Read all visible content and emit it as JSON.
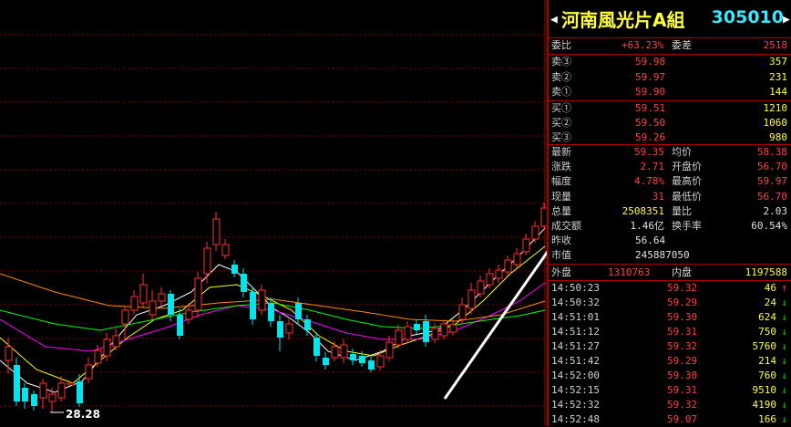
{
  "header": {
    "name": "河南風光片A組",
    "code": "305010"
  },
  "committee": {
    "ratio_label": "委比",
    "ratio_value": "+63.23%",
    "diff_label": "委差",
    "diff_value": "2518"
  },
  "sell": [
    {
      "label": "卖③",
      "price": "59.98",
      "vol": "357"
    },
    {
      "label": "卖②",
      "price": "59.97",
      "vol": "231"
    },
    {
      "label": "卖①",
      "price": "59.90",
      "vol": "144"
    }
  ],
  "buy": [
    {
      "label": "买①",
      "price": "59.51",
      "vol": "1210"
    },
    {
      "label": "买②",
      "price": "59.50",
      "vol": "1060"
    },
    {
      "label": "买③",
      "price": "59.26",
      "vol": "980"
    }
  ],
  "stats": [
    {
      "l1": "最新",
      "v1": "59.35",
      "l2": "均价",
      "v2": "58.38"
    },
    {
      "l1": "涨跌",
      "v1": "2.71",
      "l2": "开盘价",
      "v2": "56.70"
    },
    {
      "l1": "幅度",
      "v1": "4.78%",
      "l2": "最高价",
      "v2": "59.97"
    },
    {
      "l1": "现量",
      "v1": "31",
      "l2": "最低价",
      "v2": "56.70"
    },
    {
      "l1": "总量",
      "v1": "2508351",
      "l2": "量比",
      "v2": "2.03"
    },
    {
      "l1": "成交额",
      "v1": "1.46亿",
      "l2": "换手率",
      "v2": "60.54%"
    },
    {
      "l1": "昨收",
      "v1": "56.64",
      "l2": "",
      "v2": ""
    },
    {
      "l1": "市值",
      "v1": "245887050",
      "l2": "",
      "v2": ""
    }
  ],
  "outer": {
    "out_label": "外盘",
    "out_value": "1310763",
    "in_label": "内盘",
    "in_value": "1197588"
  },
  "ticks": [
    {
      "time": "14:50:23",
      "price": "59.32",
      "vol": "46",
      "dir": "up"
    },
    {
      "time": "14:50:32",
      "price": "59.29",
      "vol": "24",
      "dir": "down"
    },
    {
      "time": "14:51:01",
      "price": "59.30",
      "vol": "624",
      "dir": "down"
    },
    {
      "time": "14:51:12",
      "price": "59.31",
      "vol": "750",
      "dir": "down"
    },
    {
      "time": "14:51:27",
      "price": "59.32",
      "vol": "5760",
      "dir": "down"
    },
    {
      "time": "14:51:42",
      "price": "59.29",
      "vol": "214",
      "dir": "down"
    },
    {
      "time": "14:52:00",
      "price": "59.30",
      "vol": "760",
      "dir": "down"
    },
    {
      "time": "14:52:15",
      "price": "59.31",
      "vol": "9510",
      "dir": "down"
    },
    {
      "time": "14:52:32",
      "price": "59.32",
      "vol": "4190",
      "dir": "down"
    },
    {
      "time": "14:52:48",
      "price": "59.07",
      "vol": "166",
      "dir": "down"
    }
  ],
  "chart": {
    "low_label": "28.28",
    "colors": {
      "up": "#ff3030",
      "down": "#00e5ee",
      "ma5": "#ffffff",
      "ma10": "#ffff00",
      "ma20": "#ff00ff",
      "ma30": "#00ff00",
      "ma60": "#ff8c00"
    }
  }
}
